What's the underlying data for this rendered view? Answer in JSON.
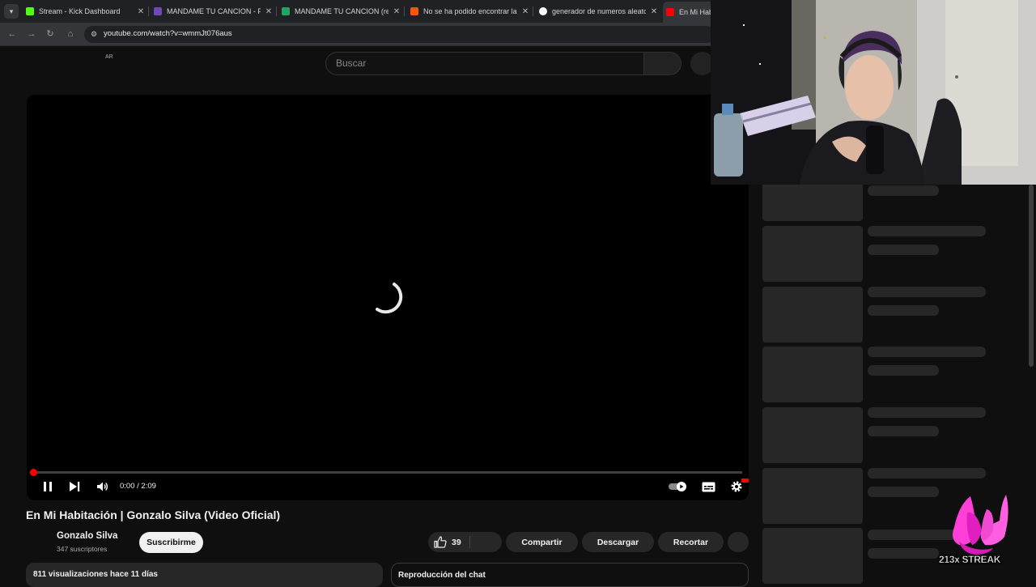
{
  "browser": {
    "tabs": [
      {
        "label": "Stream - Kick Dashboard",
        "favicon_color": "#53fc18",
        "favicon": "kick-icon"
      },
      {
        "label": "MANDAME TU CANCION - Forms",
        "favicon_color": "#7248b9",
        "favicon": "google-forms-icon"
      },
      {
        "label": "MANDAME TU CANCION (respuestas)",
        "favicon_color": "#1fa463",
        "favicon": "google-sheets-icon"
      },
      {
        "label": "No se ha podido encontrar la página",
        "favicon_color": "#ff5500",
        "favicon": "soundcloud-icon"
      },
      {
        "label": "generador de numeros aleatorios",
        "favicon_color": "#ffffff",
        "favicon": "google-icon"
      },
      {
        "label": "En Mi Habitación",
        "favicon_color": "#ff0000",
        "favicon": "youtube-icon"
      }
    ],
    "url": "youtube.com/watch?v=wmmJt076aus"
  },
  "masthead": {
    "country_code": "AR",
    "search_placeholder": "Buscar"
  },
  "player": {
    "time": "0:00 / 2:09",
    "progress": 0,
    "state": "loading"
  },
  "video": {
    "title": "En Mi Habitación | Gonzalo Silva (Video Oficial)",
    "channel": "Gonzalo Silva",
    "subscribers": "347 suscriptores",
    "subscribe_label": "Suscribirme",
    "likes": "39",
    "share_label": "Compartir",
    "download_label": "Descargar",
    "clip_label": "Recortar",
    "views_date": "811 visualizaciones  hace 11 días",
    "chat_replay": "Reproducción del chat"
  },
  "overlay": {
    "streak_text": "213x STREAK"
  },
  "colors": {
    "background": "#0f0f0f",
    "accent_red": "#ff0000",
    "pill": "#272727",
    "streak_pink": "#ff3fd8"
  }
}
